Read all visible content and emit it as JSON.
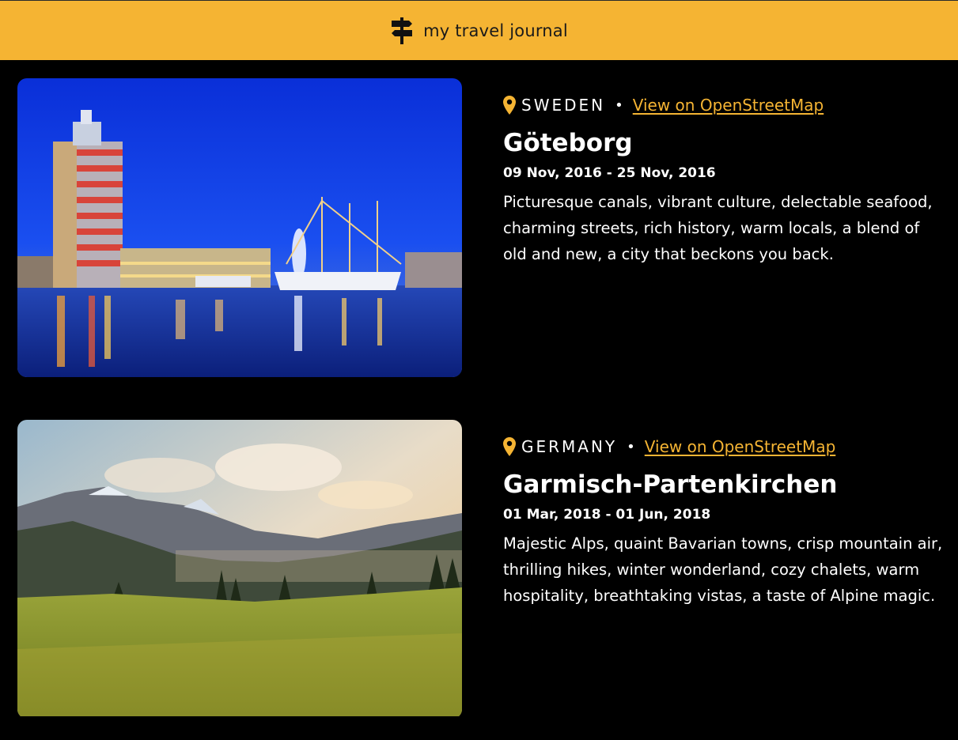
{
  "header": {
    "title": "my travel journal",
    "icon": "signpost-icon",
    "background": "#F5B433"
  },
  "entries": [
    {
      "country": "SWEDEN",
      "separator": "•",
      "map_link": "View on OpenStreetMap",
      "title": "Göteborg",
      "dates": "09 Nov, 2016 - 25 Nov, 2016",
      "description": "Picturesque canals, vibrant culture, delectable seafood, charming streets, rich history, warm locals, a blend of old and new, a city that beckons you back.",
      "image": "goteborg-harbor-photo"
    },
    {
      "country": "GERMANY",
      "separator": "•",
      "map_link": "View on OpenStreetMap",
      "title": "Garmisch-Partenkirchen",
      "dates": "01 Mar, 2018 - 01 Jun, 2018",
      "description": "Majestic Alps, quaint Bavarian towns, crisp mountain air, thrilling hikes, winter wonderland, cozy chalets, warm hospitality, breathtaking vistas, a taste of Alpine magic.",
      "image": "alps-meadow-photo"
    }
  ],
  "accent_color": "#F5B433"
}
